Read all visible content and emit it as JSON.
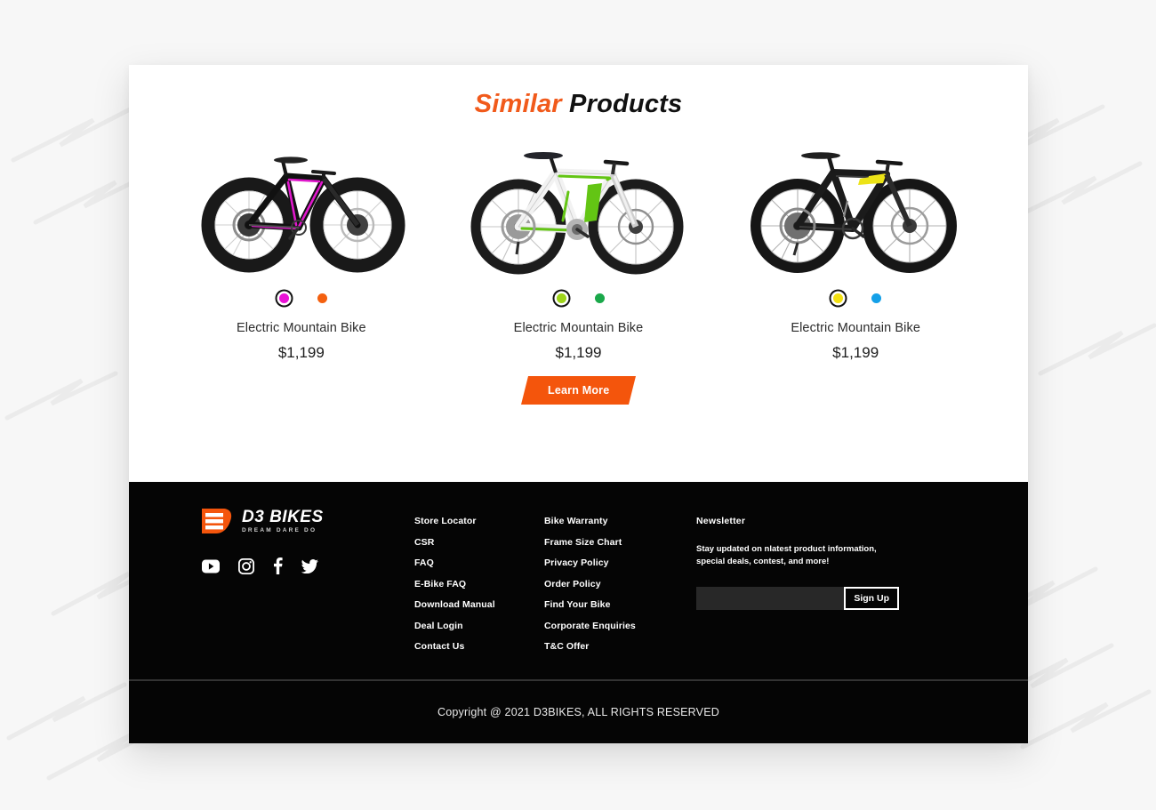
{
  "section": {
    "title_accent": "Similar",
    "title_rest": "Products",
    "title_accent_color": "#f15a1b"
  },
  "products": [
    {
      "name": "Electric Mountain Bike",
      "price": "$1,199",
      "image_alt": "black fat tire mountain bike with magenta accents",
      "swatches": [
        {
          "color": "#ea13d6",
          "selected": true
        },
        {
          "color": "#f4600f",
          "selected": false
        }
      ]
    },
    {
      "name": "Electric Mountain Bike",
      "price": "$1,199",
      "image_alt": "white electric mountain bike with green accents",
      "swatches": [
        {
          "color": "#9ed41a",
          "selected": true
        },
        {
          "color": "#1aa84a",
          "selected": false
        }
      ]
    },
    {
      "name": "Electric Mountain Bike",
      "price": "$1,199",
      "image_alt": "black mountain bike with yellow accents",
      "swatches": [
        {
          "color": "#f3e112",
          "selected": true
        },
        {
          "color": "#14a0e8",
          "selected": false
        }
      ]
    }
  ],
  "cta": {
    "learn_more_label": "Learn More",
    "button_color": "#f4550c"
  },
  "footer": {
    "logo": {
      "title": "D3 BIKES",
      "tagline": "DREAM  DARE  DO",
      "mark_color": "#f4550c"
    },
    "social": [
      {
        "name": "youtube-icon",
        "label": "YouTube"
      },
      {
        "name": "instagram-icon",
        "label": "Instagram"
      },
      {
        "name": "facebook-icon",
        "label": "Facebook"
      },
      {
        "name": "twitter-icon",
        "label": "Twitter"
      }
    ],
    "links_col1": [
      "Store Locator",
      "CSR",
      "FAQ",
      "E-Bike FAQ",
      "Download Manual",
      "Deal Login",
      "Contact Us"
    ],
    "links_col2": [
      "Bike Warranty",
      "Frame Size Chart",
      "Privacy Policy",
      "Order Policy",
      "Find Your Bike",
      "Corporate Enquiries",
      "T&C Offer"
    ],
    "newsletter": {
      "title": "Newsletter",
      "description": "Stay updated on nlatest product information, special deals, contest, and more!",
      "input_value": "",
      "input_placeholder": "",
      "signup_label": "Sign Up"
    },
    "copyright": "Copyright @ 2021 D3BIKES, ALL RIGHTS RESERVED"
  }
}
